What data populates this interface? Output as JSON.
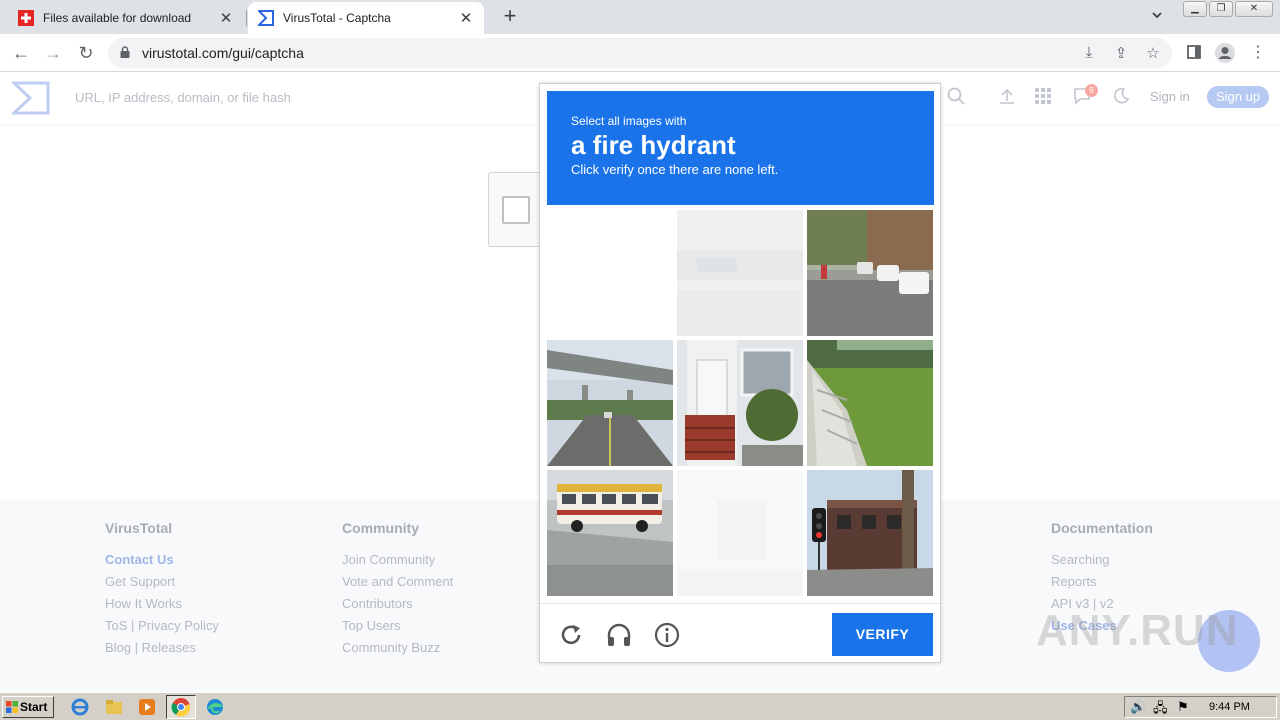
{
  "browser": {
    "tabs": [
      {
        "title": "Files available for download",
        "active": false
      },
      {
        "title": "VirusTotal - Captcha",
        "active": true
      }
    ],
    "url": "virustotal.com/gui/captcha"
  },
  "vt": {
    "search_placeholder": "URL, IP address, domain, or file hash",
    "notification_count": "9",
    "signin": "Sign in",
    "signup": "Sign up"
  },
  "footer": {
    "columns": [
      {
        "title": "VirusTotal",
        "items": [
          "Contact Us",
          "Get Support",
          "How It Works",
          "ToS | Privacy Policy",
          "Blog | Releases"
        ]
      },
      {
        "title": "Community",
        "items": [
          "Join Community",
          "Vote and Comment",
          "Contributors",
          "Top Users",
          "Community Buzz"
        ]
      },
      {
        "title": "Documentation",
        "items": [
          "Searching",
          "Reports",
          "API v3 | v2",
          "Use Cases"
        ]
      }
    ]
  },
  "captcha": {
    "instruction_small": "Select all images with",
    "target": "a fire hydrant",
    "instruction_sub": "Click verify once there are none left.",
    "verify_label": "VERIFY"
  },
  "watermark": "ANY.RUN",
  "taskbar": {
    "start_label": "Start",
    "clock": "9:44 PM"
  },
  "colors": {
    "captcha_blue": "#1a73e8",
    "vt_link": "#9fb5e6"
  }
}
